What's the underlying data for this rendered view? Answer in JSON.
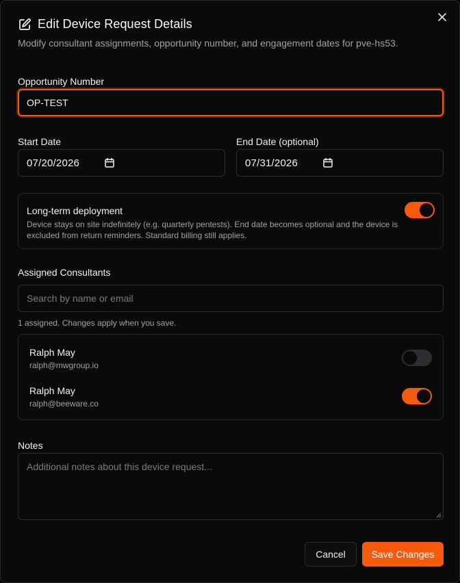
{
  "dialog": {
    "title": "Edit Device Request Details",
    "subtitle": "Modify consultant assignments, opportunity number, and engagement dates for pve-hs53.",
    "accent_color": "#f55a0d"
  },
  "form": {
    "opportunity": {
      "label": "Opportunity Number",
      "value": "OP-TEST"
    },
    "start_date": {
      "label": "Start Date",
      "value": "07/20/2026"
    },
    "end_date": {
      "label": "End Date (optional)",
      "value": "07/31/2026"
    },
    "long_term": {
      "title": "Long-term deployment",
      "description": "Device stays on site indefinitely (e.g. quarterly pentests). End date becomes optional and the device is excluded from return reminders. Standard billing still applies.",
      "enabled": true
    },
    "consultants": {
      "label": "Assigned Consultants",
      "search_placeholder": "Search by name or email",
      "hint": "1 assigned. Changes apply when you save.",
      "items": [
        {
          "name": "Ralph May",
          "email": "ralph@mwgroup.io",
          "assigned": false
        },
        {
          "name": "Ralph May",
          "email": "ralph@beeware.co",
          "assigned": true
        }
      ]
    },
    "notes": {
      "label": "Notes",
      "placeholder": "Additional notes about this device request..."
    }
  },
  "actions": {
    "cancel_label": "Cancel",
    "save_label": "Save Changes"
  }
}
